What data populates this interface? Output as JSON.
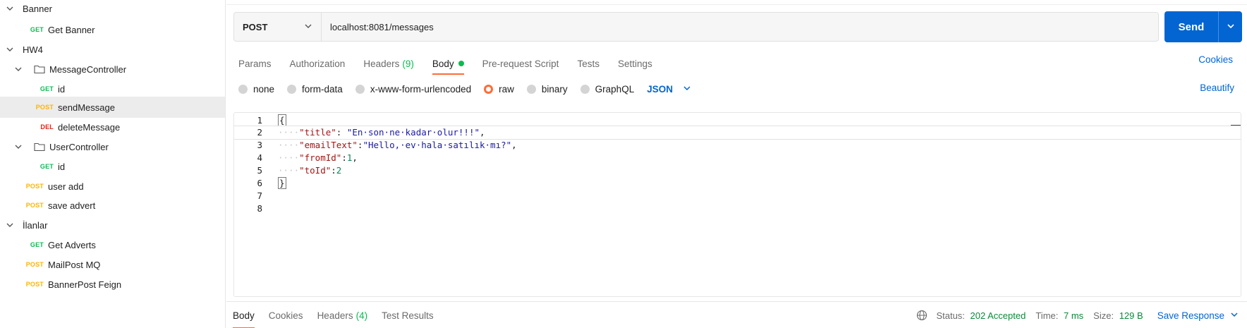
{
  "sidebar": {
    "rows": [
      {
        "type": "folder-root",
        "label": "Banner"
      },
      {
        "type": "request",
        "method": "GET",
        "label": "Get Banner"
      },
      {
        "type": "folder-root",
        "label": "HW4"
      },
      {
        "type": "folder",
        "label": "MessageController"
      },
      {
        "type": "request",
        "method": "GET",
        "label": "id"
      },
      {
        "type": "request",
        "method": "POST",
        "label": "sendMessage"
      },
      {
        "type": "request",
        "method": "DEL",
        "label": "deleteMessage"
      },
      {
        "type": "folder",
        "label": "UserController"
      },
      {
        "type": "request",
        "method": "GET",
        "label": "id"
      },
      {
        "type": "request",
        "method": "POST",
        "label": "user add"
      },
      {
        "type": "request",
        "method": "POST",
        "label": "save advert"
      },
      {
        "type": "folder-root",
        "label": "İlanlar"
      },
      {
        "type": "request",
        "method": "GET",
        "label": "Get Adverts"
      },
      {
        "type": "request",
        "method": "POST",
        "label": "MailPost MQ"
      },
      {
        "type": "request",
        "method": "POST",
        "label": "BannerPost Feign"
      }
    ]
  },
  "request": {
    "method": "POST",
    "url": "localhost:8081/messages",
    "send_label": "Send"
  },
  "tabs": {
    "params": "Params",
    "authorization": "Authorization",
    "headers": "Headers",
    "headers_count": "(9)",
    "body": "Body",
    "prerequest": "Pre-request Script",
    "tests": "Tests",
    "settings": "Settings",
    "cookies": "Cookies"
  },
  "body_types": {
    "none": "none",
    "form_data": "form-data",
    "urlencoded": "x-www-form-urlencoded",
    "raw": "raw",
    "binary": "binary",
    "graphql": "GraphQL",
    "json": "JSON",
    "beautify": "Beautify",
    "selected": "raw"
  },
  "editor": {
    "line_numbers": [
      "1",
      "2",
      "3",
      "4",
      "5",
      "6",
      "7",
      "8"
    ],
    "lines": [
      [
        {
          "t": "p",
          "v": "{"
        }
      ],
      [
        {
          "t": "ws",
          "v": "····"
        },
        {
          "t": "k",
          "v": "\"title\""
        },
        {
          "t": "p",
          "v": ": "
        },
        {
          "t": "s",
          "v": "\"En·son·ne·kadar·olur!!!\""
        },
        {
          "t": "p",
          "v": ","
        }
      ],
      [
        {
          "t": "ws",
          "v": "····"
        },
        {
          "t": "k",
          "v": "\"emailText\""
        },
        {
          "t": "p",
          "v": ":"
        },
        {
          "t": "s",
          "v": "\"Hello,·ev·hala·satılık·mı?\""
        },
        {
          "t": "p",
          "v": ","
        }
      ],
      [
        {
          "t": "ws",
          "v": "····"
        },
        {
          "t": "k",
          "v": "\"fromId\""
        },
        {
          "t": "p",
          "v": ":"
        },
        {
          "t": "n",
          "v": "1"
        },
        {
          "t": "p",
          "v": ","
        }
      ],
      [
        {
          "t": "ws",
          "v": "····"
        },
        {
          "t": "k",
          "v": "\"toId\""
        },
        {
          "t": "p",
          "v": ":"
        },
        {
          "t": "n",
          "v": "2"
        }
      ],
      [
        {
          "t": "p",
          "v": "}"
        }
      ],
      [],
      []
    ]
  },
  "response": {
    "tabs": {
      "body": "Body",
      "cookies": "Cookies",
      "headers": "Headers",
      "headers_count": "(4)",
      "test_results": "Test Results"
    },
    "status_label": "Status:",
    "status_value": "202 Accepted",
    "time_label": "Time:",
    "time_value": "7 ms",
    "size_label": "Size:",
    "size_value": "129 B",
    "save_label": "Save Response"
  },
  "colors": {
    "accent_orange": "#ff6c37",
    "primary_blue": "#0265d2",
    "get_green": "#0cbb52",
    "post_yellow": "#ffb400",
    "delete_red": "#eb2013"
  }
}
